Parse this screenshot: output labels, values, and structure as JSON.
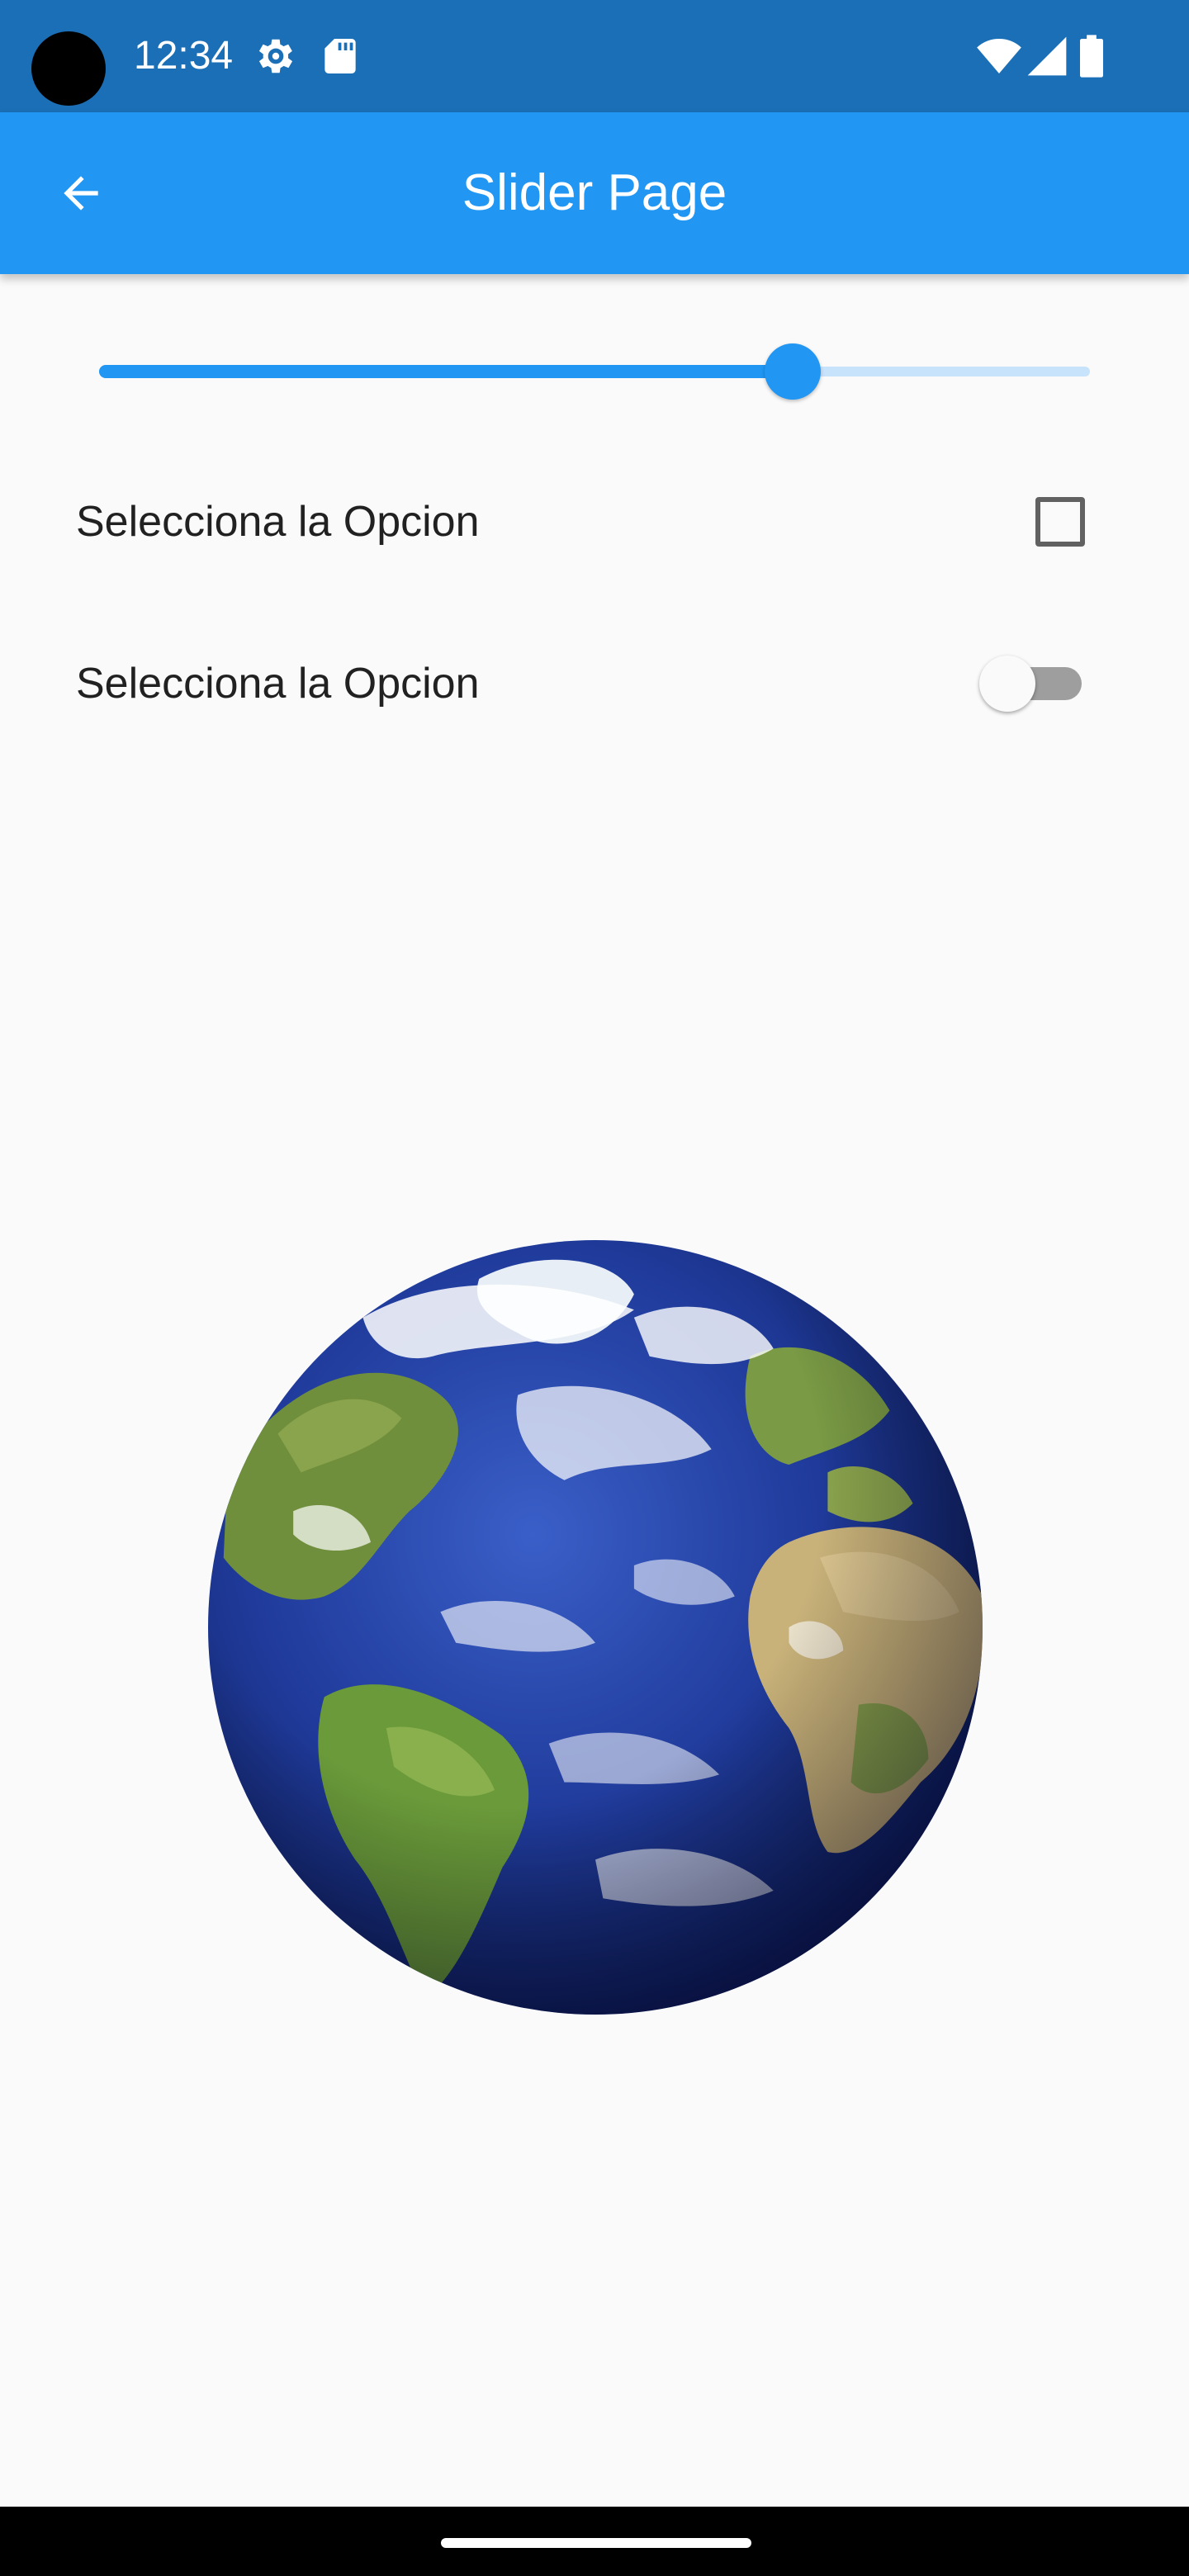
{
  "status_bar": {
    "time": "12:34",
    "icons": [
      "settings-gear-icon",
      "sd-card-icon",
      "wifi-icon",
      "cell-signal-icon",
      "battery-icon"
    ],
    "background_color": "#1a6fb6"
  },
  "app_bar": {
    "title": "Slider Page",
    "back_icon": "arrow-back-icon",
    "background_color": "#2196f3"
  },
  "slider": {
    "value_fraction": 0.7,
    "active_color": "#2196f3",
    "inactive_color": "#c7e3fb"
  },
  "checkbox_row": {
    "label": "Selecciona la Opcion",
    "checked": false
  },
  "switch_row": {
    "label": "Selecciona la Opcion",
    "on": false
  },
  "image": {
    "subject": "earth-globe-icon"
  }
}
